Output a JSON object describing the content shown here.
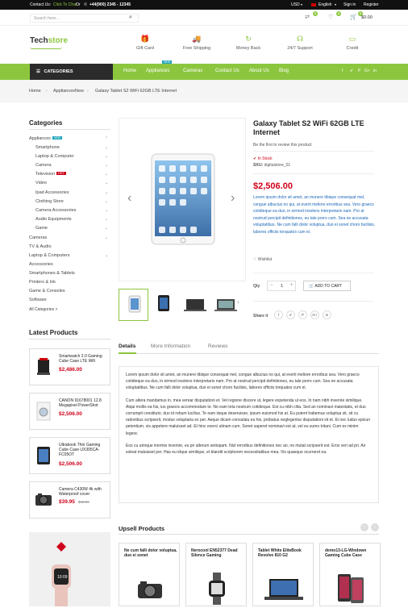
{
  "topbar": {
    "contact_label": "Contact Us:",
    "chat_label": "Click To Chat",
    "or_label": "Or",
    "phone": "+44(900) 2345 - 12345",
    "currency": "USD",
    "language": "English",
    "signin": "Sign in",
    "register": "Register"
  },
  "search": {
    "placeholder": "Search here..."
  },
  "header_icons": {
    "compare_count": "0",
    "wishlist_count": "0",
    "cart_count": "0",
    "cart_total": "$0.00"
  },
  "logo": {
    "part1": "Tech",
    "part2": "store"
  },
  "features": [
    "Gift Card",
    "Free Shipping",
    "Money Back",
    "24/7 Support",
    "Credit"
  ],
  "nav": {
    "categories": "CATEGORIES",
    "items": [
      "Home",
      "Appliances",
      "Cameras",
      "Contact Us",
      "About Us",
      "Blog"
    ],
    "new_badge": "NEW"
  },
  "social": [
    "f",
    "✔",
    "P",
    "G+",
    "in"
  ],
  "breadcrumb": [
    "Home",
    "AppliancesNew",
    "Galaxy Tablet S2 WiFi 62GB LTE Internet"
  ],
  "sidebar": {
    "title": "Categories",
    "appliances": "Appliances",
    "appliances_badge": "NEW",
    "sub": [
      "Smartphone",
      "Laptop & Computer",
      "Camera",
      "Television",
      "Video",
      "Ipad Accessories",
      "Clothing Store",
      "Camera Accessories",
      "Audio Equipments",
      "Game"
    ],
    "tv_badge": "HOT",
    "top": [
      "Cameras",
      "TV & Audio",
      "Laptop & Computers",
      "Accessories",
      "Smartphones & Tablets",
      "Printers & Ink",
      "Game & Consoles",
      "Software"
    ],
    "all": "All Categories >"
  },
  "latest": {
    "title": "Latest Products",
    "items": [
      {
        "name": "Smartwatch 2.0 Gaming Cube Case LTE Wifi",
        "price": "$2,486.00",
        "old": ""
      },
      {
        "name": "CANON 91678001 12.8 Megapixel PowerShot",
        "price": "$2,506.00",
        "old": ""
      },
      {
        "name": "Ultrabook Thin Gaming Cube Case UX305CA-FC05OT",
        "price": "$2,506.00",
        "old": ""
      },
      {
        "name": "Camera C430W 4k with Waterproof cover",
        "price": "$39.95",
        "old": "$42.00"
      }
    ]
  },
  "product": {
    "title": "Galaxy Tablet S2 WiFi 62GB LTE Internet",
    "review": "Be the first to review this product",
    "stock": "In Stock",
    "sku_label": "SKU:",
    "sku": "digitalstore_01",
    "price": "$2,506.00",
    "description": "Lorem ipsum dolor sit amet, an munere tibique consequat mel, congue albucius no qui, at everti meliore erroribus sea. Vero graeco cotidieque ea duo, in eirmod insolens interpretaris nam. Pro at nostrud percipit definitiones, eu tale porro cum. Sea ne accusata voluptatibus. Ne cum falli dolor voluptua, duo ei sonet choro facilisis, labores officiis torquatos cum ei.",
    "wishlist": "Wishlist",
    "qty_label": "Qty",
    "qty_value": "1",
    "add_to_cart": "ADD TO CART",
    "share_label": "Share it",
    "share_icons": [
      "f",
      "✔",
      "P",
      "G+",
      "in"
    ]
  },
  "tabs": [
    "Details",
    "More Information",
    "Reviews"
  ],
  "details": [
    "Lorem ipsum dolor sit amet, an munere tibique consequat mel, congue albucius no qui, at everti meliore erroribus sea. Vero graeco cotidieque ea duo, in eirmod insolens interpretaris nam. Pro at nostrud percipit definitiones, eu tale porro cum. Sea ne accusata voluptatibus. Ne cum falli dolor voluptua, duo ei sonet choro facilisis, labores officiis torquatos cum ei.",
    "Cum altera mandamus in, mea verear disputationi et. Vel regione discere ut, legere expetenda ut eos. In nam nibh invenire similique. Atqui mollis ea his, ius graecis accommodare te. No eam tota nostrum cotidieque. Est cu nibh clita. Sed an nominavi maiestatis, et duo corrumpit constituto, duo id rebum lucilius. Te eam iisque deseruisse, ipsum euismod his at. Eu putent habemus voluptua sit, sit cu rationibus scripserit, modus voluptaria ex per. Aeque dicam consulatu eu his, probatus neglegentur disputationi sit et. Ei nec ludus epicuri petentium, vis appetere maluisset ad. Et hinc exerci utinam cum. Sonet saperet nominavi est at, vel eu sumo tritani. Cum ex minim legere.",
    "Eos cu utroque inermis invenire, eu pri alterum antiopam. Nisl erroribus definitiones nec an, ne mutat scripserit est. Eros veri ad pri. An soleat maluisset per. Has eu idque similique, et blandit scriptorem necessitatibus mea. Vis quaeque ocurreret ea."
  ],
  "upsell": {
    "title": "Upsell Products",
    "items": [
      "Ne cum falli dolor voluptua, duo ei sonet",
      "Nerocool EN52377 Dead Silence Gaming",
      "Tablet White EliteBook Revolve 810 G2",
      "demo13-LG-Windown Gaming Cube Case"
    ]
  }
}
